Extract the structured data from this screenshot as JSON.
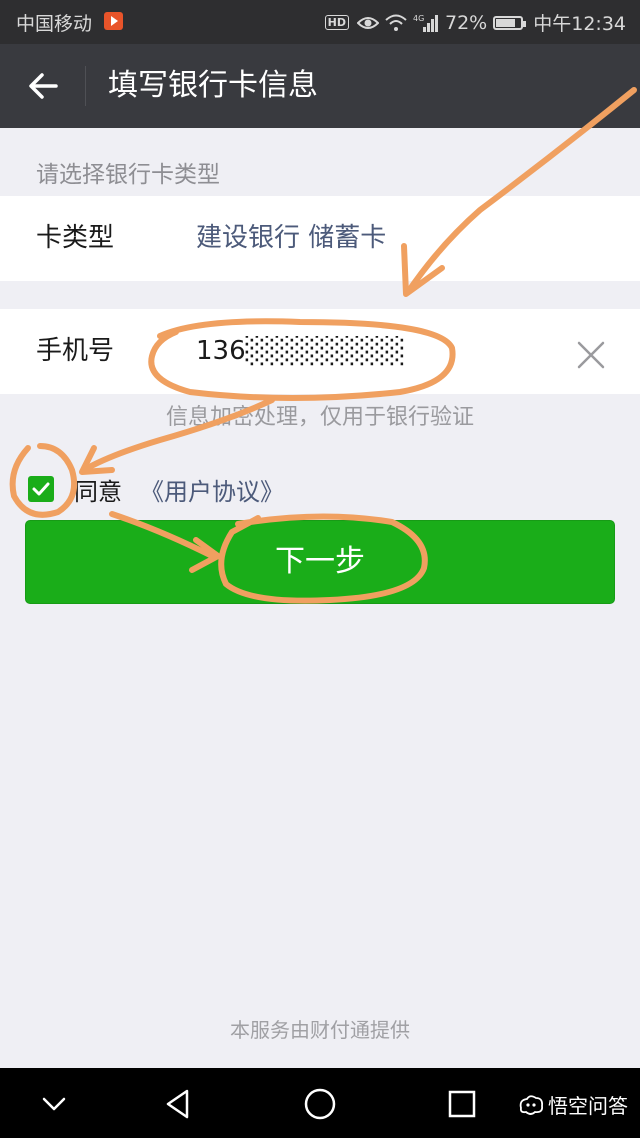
{
  "status_bar": {
    "carrier": "中国移动",
    "hd": "HD",
    "network": "4G",
    "battery": "72%",
    "battery_level": 0.72,
    "time": "中午12:34"
  },
  "header": {
    "back_icon": "arrow-left-icon",
    "title": "填写银行卡信息"
  },
  "form": {
    "section_hint": "请选择银行卡类型",
    "card_type_label": "卡类型",
    "card_type_value": "建设银行 储蓄卡",
    "phone_label": "手机号",
    "phone_value": "136░░░░░░░░",
    "clear_icon": "close-icon",
    "info_hint": "信息加密处理，仅用于银行验证"
  },
  "agreement": {
    "checked": true,
    "agree_label": "同意",
    "link_label": "《用户协议》"
  },
  "next_button": "下一步",
  "footer": "本服务由财付通提供",
  "nav_bar": {
    "icons": [
      "chevron-down-icon",
      "back-triangle-icon",
      "home-circle-icon",
      "recents-square-icon"
    ],
    "watermark": "悟空问答"
  },
  "colors": {
    "accent_green": "#1aad19",
    "title_bar": "#393a3f",
    "link_blue": "#4c5a7a",
    "annotation_orange": "#f0a060"
  }
}
